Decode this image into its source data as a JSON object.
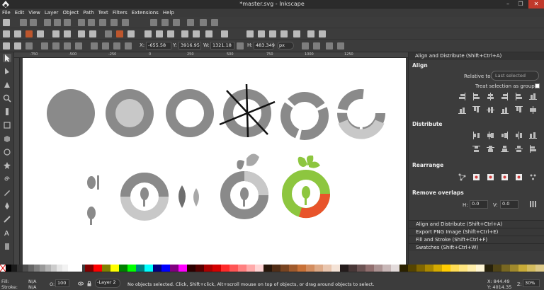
{
  "window": {
    "title": "*master.svg - Inkscape",
    "minimize": "–",
    "maximize": "❐",
    "close": "✕"
  },
  "menu": [
    "File",
    "Edit",
    "View",
    "Layer",
    "Object",
    "Path",
    "Text",
    "Filters",
    "Extensions",
    "Help"
  ],
  "controls": {
    "x_label": "X:",
    "x_value": "-655.58",
    "y_label": "Y:",
    "y_value": "3916.95",
    "w_label": "W:",
    "w_value": "1321.18",
    "h_label": "H:",
    "h_value": "483.349",
    "unit": "px"
  },
  "ruler_marks": [
    "-750",
    "-500",
    "-250",
    "0",
    "250",
    "500",
    "750",
    "1000",
    "1250"
  ],
  "panel": {
    "title": "Align and Distribute (Shift+Ctrl+A)",
    "align_heading": "Align",
    "relative_to_label": "Relative to:",
    "relative_to_value": "Last selected",
    "treat_as_group_label": "Treat selection as group:",
    "distribute_heading": "Distribute",
    "rearrange_heading": "Rearrange",
    "remove_overlaps_heading": "Remove overlaps",
    "h_label": "H:",
    "h_value": "0.0",
    "v_label": "V:",
    "v_value": "0.0"
  },
  "docked_dialogs": [
    "Align and Distribute (Shift+Ctrl+A)",
    "Export PNG Image (Shift+Ctrl+E)",
    "Fill and Stroke (Shift+Ctrl+F)",
    "Swatches (Shift+Ctrl+W)"
  ],
  "status": {
    "fill_label": "Fill:",
    "fill_value": "N/A",
    "stroke_label": "Stroke:",
    "stroke_value": "N/A",
    "opacity_label": "O:",
    "opacity_value": "100",
    "layer": "-Layer 2",
    "message": "No objects selected. Click, Shift+click, Alt+scroll mouse on top of objects, or drag around objects to select.",
    "cursor_x": "X: 844.49",
    "cursor_y": "Y: 4014.35",
    "zoom_label": "Z:",
    "zoom_value": "30%"
  },
  "colors": {
    "circle_gray": "#8a8a8a",
    "light_gray": "#c8c8c8",
    "green": "#8dc63f",
    "orange": "#e8542b"
  }
}
